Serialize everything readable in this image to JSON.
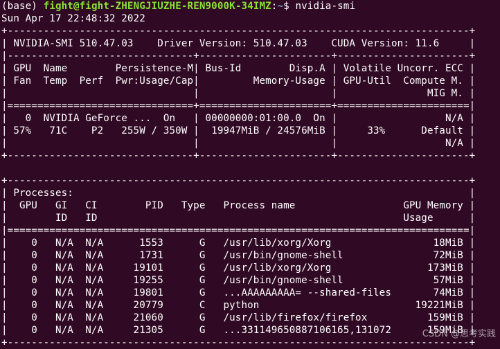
{
  "terminal": {
    "env": "(base)",
    "user_host": "fight@fight-ZHENGJIUZHE-REN9000K-34IMZ",
    "colon": ":",
    "cwd": "~",
    "dollar": "$",
    "command": "nvidia-smi",
    "timestamp": "Sun Apr 17 22:48:32 2022",
    "lines": [
      "+-----------------------------------------------------------------------------+",
      "| NVIDIA-SMI 510.47.03    Driver Version: 510.47.03    CUDA Version: 11.6     |",
      "|-------------------------------+----------------------+----------------------+",
      "| GPU  Name        Persistence-M| Bus-Id        Disp.A | Volatile Uncorr. ECC |",
      "| Fan  Temp  Perf  Pwr:Usage/Cap|         Memory-Usage | GPU-Util  Compute M. |",
      "|                               |                      |               MIG M. |",
      "|===============================+======================+======================|",
      "|   0  NVIDIA GeForce ...  On   | 00000000:01:00.0  On |                  N/A |",
      "| 57%   71C    P2   255W / 350W |  19947MiB / 24576MiB |     33%      Default |",
      "|                               |                      |                  N/A |",
      "+-------------------------------+----------------------+----------------------+",
      "",
      "+-----------------------------------------------------------------------------+",
      "| Processes:                                                                  |",
      "|  GPU   GI   CI        PID   Type   Process name                  GPU Memory |",
      "|        ID   ID                                                   Usage      |",
      "|=============================================================================|",
      "|    0   N/A  N/A      1553      G   /usr/lib/xorg/Xorg                 18MiB |",
      "|    0   N/A  N/A      1731      G   /usr/bin/gnome-shell               72MiB |",
      "|    0   N/A  N/A     19101      G   /usr/lib/xorg/Xorg                173MiB |",
      "|    0   N/A  N/A     19255      G   /usr/bin/gnome-shell               57MiB |",
      "|    0   N/A  N/A     19801      G   ...AAAAAAAAA= --shared-files       74MiB |",
      "|    0   N/A  N/A     20779      C   python                          19221MiB |",
      "|    0   N/A  N/A     21060      G   /usr/lib/firefox/firefox          159MiB |",
      "|    0   N/A  N/A     21305      G   ...331149650887106165,131072      159MiB |",
      "+-----------------------------------------------------------------------------+"
    ]
  },
  "watermark": "CSDN @思考实践"
}
